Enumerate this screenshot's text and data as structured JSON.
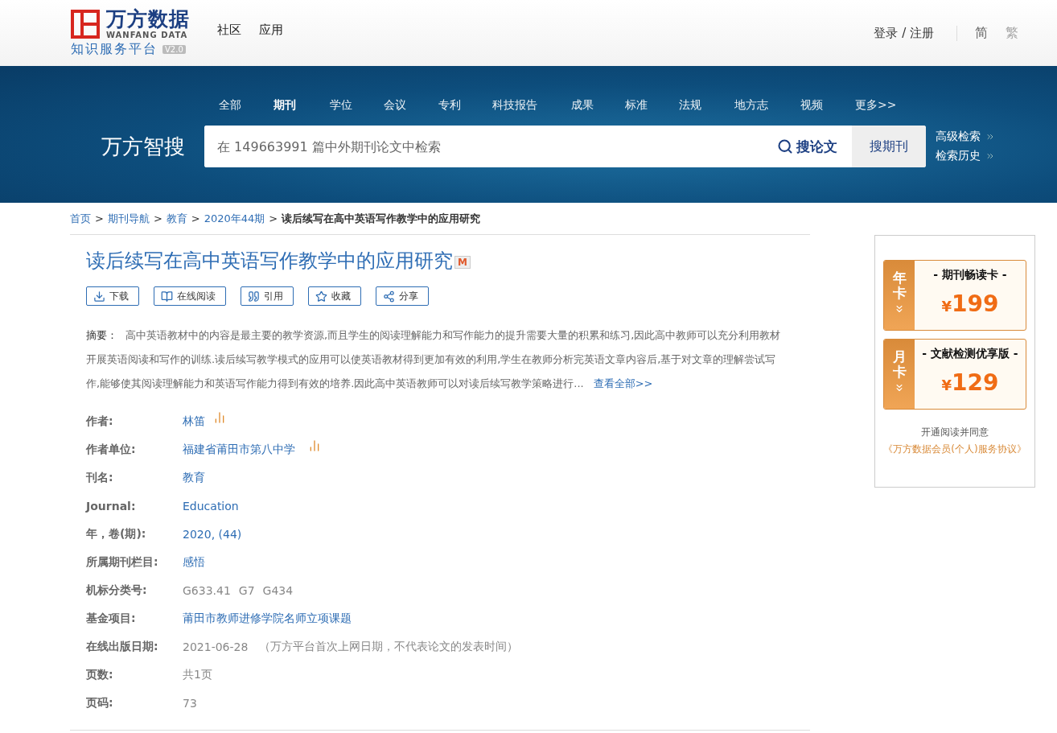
{
  "header": {
    "logo": {
      "name": "万方数据",
      "latin": "WANFANG DATA",
      "subtitle": "知识服务平台",
      "version": "V2.0"
    },
    "nav": [
      "社区",
      "应用"
    ],
    "account": "登录 / 注册",
    "languages": [
      {
        "label": "简",
        "selected": true
      },
      {
        "label": "繁",
        "selected": false
      }
    ]
  },
  "search": {
    "brand": "万方智搜",
    "tabs": [
      {
        "label": "全部",
        "selected": false
      },
      {
        "label": "期刊",
        "selected": true
      },
      {
        "label": "学位",
        "selected": false
      },
      {
        "label": "会议",
        "selected": false
      },
      {
        "label": "专利",
        "selected": false
      },
      {
        "label": "科技报告",
        "selected": false
      },
      {
        "label": "成果",
        "selected": false
      },
      {
        "label": "标准",
        "selected": false
      },
      {
        "label": "法规",
        "selected": false
      },
      {
        "label": "地方志",
        "selected": false
      },
      {
        "label": "视频",
        "selected": false
      },
      {
        "label": "更多>>",
        "selected": false
      }
    ],
    "placeholder": "在 149663991 篇中外期刊论文中检索",
    "primary_button": "搜论文",
    "secondary_button": "搜期刊",
    "links": [
      "高级检索",
      "检索历史"
    ]
  },
  "breadcrumb": [
    {
      "label": "首页",
      "current": false
    },
    {
      "separator": ">",
      "label": "期刊导航",
      "current": false
    },
    {
      "separator": ">",
      "label": "教育",
      "current": false
    },
    {
      "separator": ">",
      "label": "2020年44期",
      "current": false
    },
    {
      "separator": ">",
      "label": "读后续写在高中英语写作教学中的应用研究",
      "current": true
    }
  ],
  "article": {
    "title": "读后续写在高中英语写作教学中的应用研究",
    "badge": "M",
    "actions": [
      "下载",
      "在线阅读",
      "引用",
      "收藏",
      "分享"
    ],
    "abstract_label": "摘要：",
    "abstract": "高中英语教材中的内容是最主要的教学资源,而且学生的阅读理解能力和写作能力的提升需要大量的积累和练习,因此高中教师可以充分利用教材开展英语阅读和写作的训练.读后续写教学模式的应用可以使英语教材得到更加有效的利用,学生在教师分析完英语文章内容后,基于对文章的理解尝试写作,能够使其阅读理解能力和英语写作能力得到有效的培养.因此高中英语教师可以对读后续写教学策略进行...",
    "more_link": "查看全部>>",
    "meta": [
      {
        "label": "作者:",
        "values": [
          "林笛"
        ],
        "link": true,
        "stats_icon": true
      },
      {
        "label": "作者单位:",
        "values": [
          "福建省莆田市第八中学"
        ],
        "link": true,
        "stats_icon": true
      },
      {
        "label": "刊名:",
        "values": [
          "教育"
        ],
        "link": true,
        "stats_icon": false
      },
      {
        "label": "Journal:",
        "values": [
          "Education"
        ],
        "link": true,
        "stats_icon": false
      },
      {
        "label": "年，卷(期):",
        "values": [
          "2020, (44)"
        ],
        "link": true,
        "stats_icon": false
      },
      {
        "label": "所属期刊栏目:",
        "values": [
          "感悟"
        ],
        "link": true,
        "stats_icon": false
      },
      {
        "label": "机标分类号:",
        "values": [
          "G633.41",
          "G7",
          "G434"
        ],
        "link": false,
        "stats_icon": false
      },
      {
        "label": "基金项目:",
        "values": [
          "莆田市教师进修学院名师立项课题"
        ],
        "link": true,
        "stats_icon": false
      },
      {
        "label": "在线出版日期:",
        "values": [
          "2021-06-28"
        ],
        "note": "（万方平台首次上网日期，不代表论文的发表时间）",
        "link": false,
        "stats_icon": false
      },
      {
        "label": "页数:",
        "values": [
          "共1页"
        ],
        "link": false,
        "stats_icon": false
      },
      {
        "label": "页码:",
        "values": [
          "73"
        ],
        "link": false,
        "stats_icon": false
      }
    ]
  },
  "membership": {
    "cards": [
      {
        "tag": "年卡",
        "name": "- 期刊畅读卡 -",
        "currency": "¥",
        "price": "199"
      },
      {
        "tag": "月卡",
        "name": "- 文献检测优享版 -",
        "currency": "¥",
        "price": "129"
      }
    ],
    "agree_text": "开通阅读并同意",
    "agreement_link": "《万方数据会员(个人)服务协议》"
  }
}
